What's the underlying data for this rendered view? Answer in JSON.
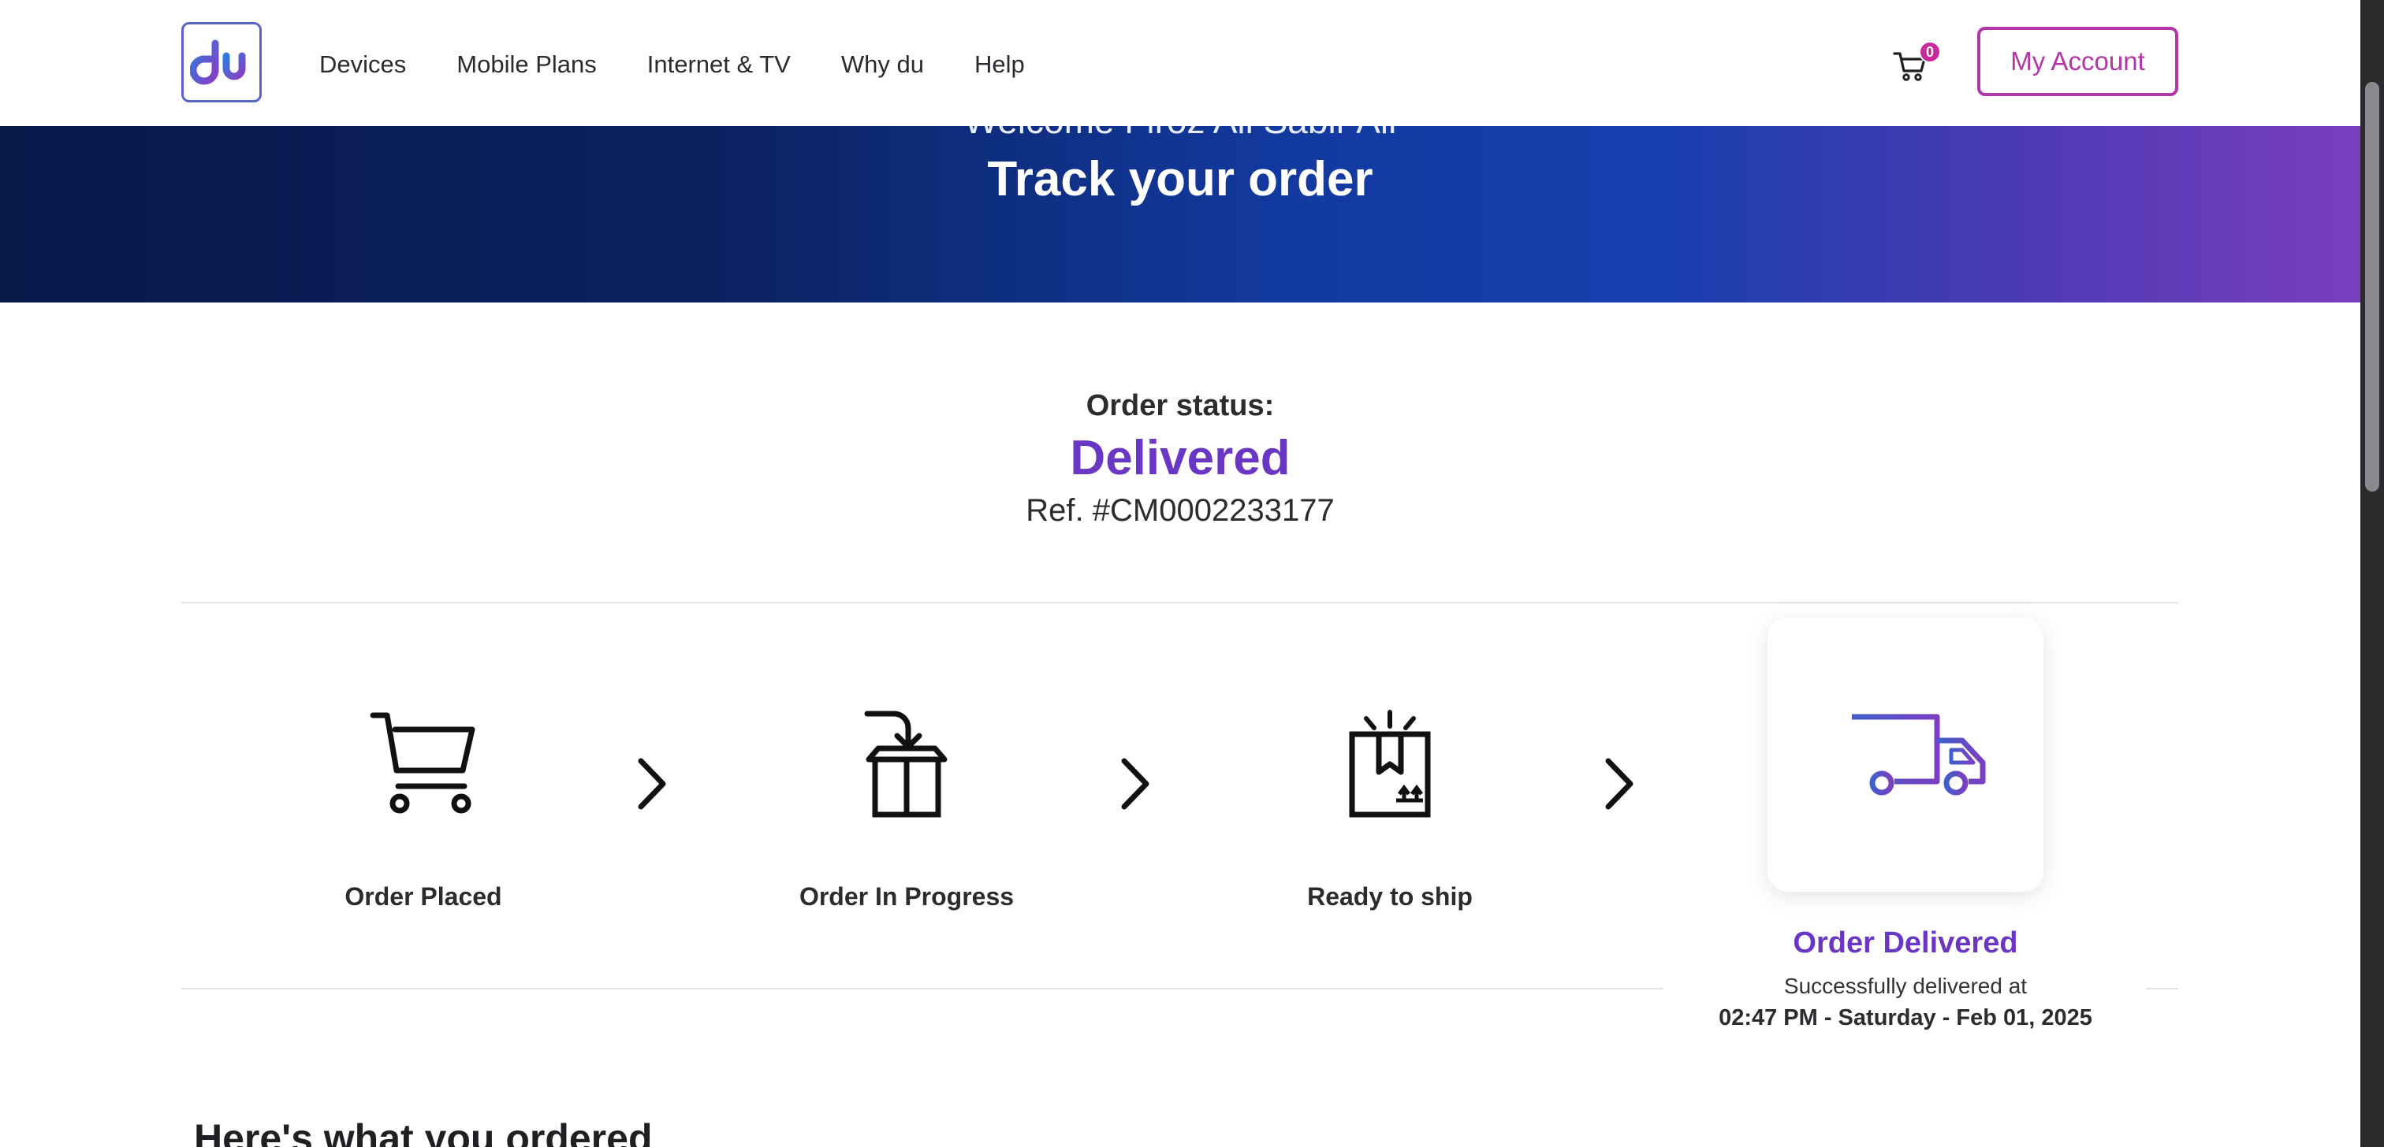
{
  "header": {
    "logo_text": "du",
    "nav": [
      "Devices",
      "Mobile Plans",
      "Internet & TV",
      "Why du",
      "Help"
    ],
    "cart_count": "0",
    "account_button": "My Account"
  },
  "banner": {
    "welcome": "Welcome Firoz Ali Sabir Ali",
    "title": "Track your order"
  },
  "order": {
    "status_label": "Order status:",
    "status_value": "Delivered",
    "reference": "Ref. #CM0002233177"
  },
  "steps": [
    {
      "label": "Order Placed",
      "icon": "cart-icon"
    },
    {
      "label": "Order In Progress",
      "icon": "box-packing-icon"
    },
    {
      "label": "Ready to ship",
      "icon": "package-ready-icon"
    }
  ],
  "delivered": {
    "title": "Order Delivered",
    "subtitle": "Successfully delivered at",
    "timestamp": "02:47 PM - Saturday - Feb 01, 2025",
    "icon": "delivery-truck-icon"
  },
  "section": {
    "ordered_heading": "Here's what you ordered"
  },
  "colors": {
    "accent_purple": "#6a37c4",
    "account_magenta": "#b236a8",
    "badge": "#c72a9c",
    "banner_dark": "#08194a",
    "banner_mid": "#173fae",
    "banner_end": "#7a3ec0"
  }
}
